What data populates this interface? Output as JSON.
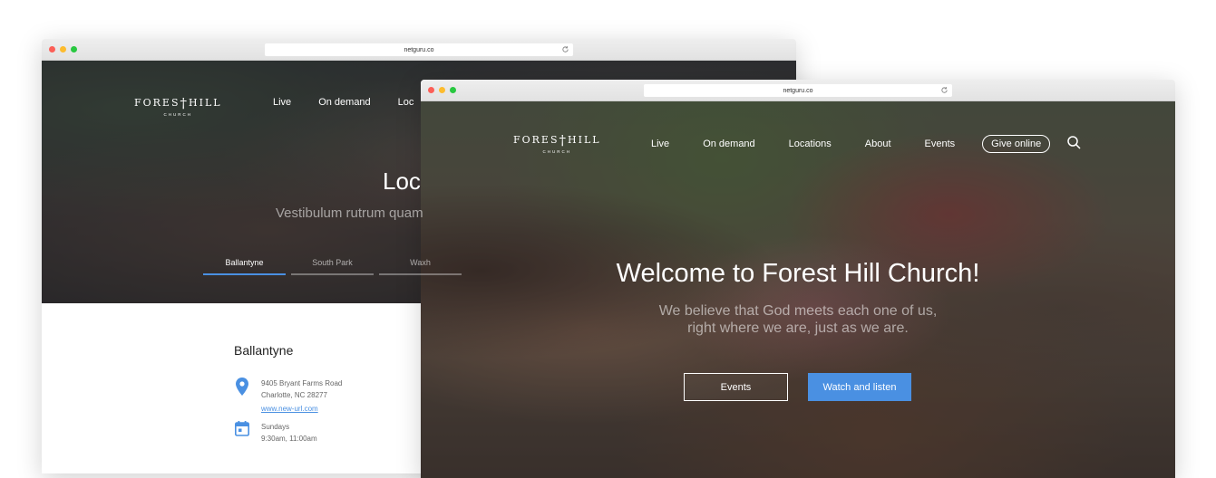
{
  "back_window": {
    "url": "netguru.co",
    "logo": {
      "main_left": "FORES",
      "main_right": "HILL",
      "sub": "CHURCH"
    },
    "nav": [
      "Live",
      "On demand",
      "Loc"
    ],
    "hero_title": "Loc",
    "hero_subtitle": "Vestibulum rutrum quam",
    "tabs": [
      "Ballantyne",
      "South Park",
      "Waxh"
    ],
    "location": {
      "name": "Ballantyne",
      "address_line1": "9405 Bryant Farms Road",
      "address_line2": "Charlotte, NC 28277",
      "url": "www.new-url.com",
      "days": "Sundays",
      "times": "9:30am, 11:00am"
    }
  },
  "front_window": {
    "url": "netguru.co",
    "logo": {
      "main_left": "FORES",
      "main_right": "HILL",
      "sub": "CHURCH"
    },
    "nav": [
      "Live",
      "On demand",
      "Locations",
      "About",
      "Events"
    ],
    "give_online": "Give online",
    "hero_title": "Welcome to Forest Hill Church!",
    "hero_subtitle_line1": "We believe that God meets each one of us,",
    "hero_subtitle_line2": "right where we are, just as we are.",
    "events_button": "Events",
    "watch_button": "Watch and listen"
  },
  "colors": {
    "accent": "#4a90e2"
  },
  "icons": [
    "reload-icon",
    "search-icon",
    "location-pin-icon",
    "calendar-icon"
  ]
}
